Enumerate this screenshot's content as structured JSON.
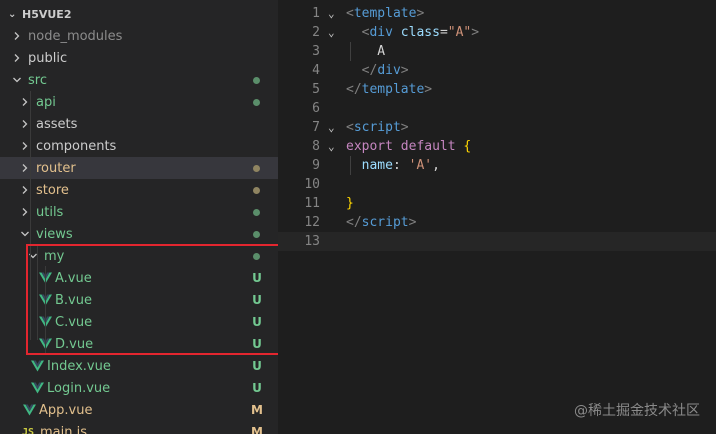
{
  "explorer": {
    "root": "H5VUE2",
    "items": [
      {
        "label": "node_modules",
        "type": "folder",
        "expanded": false,
        "depth": 1,
        "color": "#8c8c8c",
        "status": ""
      },
      {
        "label": "public",
        "type": "folder",
        "expanded": false,
        "depth": 1,
        "color": "#cccccc",
        "status": ""
      },
      {
        "label": "src",
        "type": "folder",
        "expanded": true,
        "depth": 1,
        "color": "#73c991",
        "status": "dot"
      },
      {
        "label": "api",
        "type": "folder",
        "expanded": false,
        "depth": 2,
        "color": "#73c991",
        "status": "dot"
      },
      {
        "label": "assets",
        "type": "folder",
        "expanded": false,
        "depth": 2,
        "color": "#cccccc",
        "status": ""
      },
      {
        "label": "components",
        "type": "folder",
        "expanded": false,
        "depth": 2,
        "color": "#cccccc",
        "status": ""
      },
      {
        "label": "router",
        "type": "folder",
        "expanded": false,
        "depth": 2,
        "color": "#e2c08d",
        "status": "dot-yellow",
        "selected": true
      },
      {
        "label": "store",
        "type": "folder",
        "expanded": false,
        "depth": 2,
        "color": "#e2c08d",
        "status": "dot-yellow"
      },
      {
        "label": "utils",
        "type": "folder",
        "expanded": false,
        "depth": 2,
        "color": "#73c991",
        "status": "dot"
      },
      {
        "label": "views",
        "type": "folder",
        "expanded": true,
        "depth": 2,
        "color": "#73c991",
        "status": "dot"
      },
      {
        "label": "my",
        "type": "folder",
        "expanded": true,
        "depth": 3,
        "color": "#73c991",
        "status": "dot"
      },
      {
        "label": "A.vue",
        "type": "vue",
        "depth": 4,
        "color": "#73c991",
        "status": "U"
      },
      {
        "label": "B.vue",
        "type": "vue",
        "depth": 4,
        "color": "#73c991",
        "status": "U"
      },
      {
        "label": "C.vue",
        "type": "vue",
        "depth": 4,
        "color": "#73c991",
        "status": "U"
      },
      {
        "label": "D.vue",
        "type": "vue",
        "depth": 4,
        "color": "#73c991",
        "status": "U"
      },
      {
        "label": "Index.vue",
        "type": "vue",
        "depth": 3,
        "color": "#73c991",
        "status": "U"
      },
      {
        "label": "Login.vue",
        "type": "vue",
        "depth": 3,
        "color": "#73c991",
        "status": "U"
      },
      {
        "label": "App.vue",
        "type": "vue",
        "depth": 2,
        "color": "#e2c08d",
        "status": "M"
      },
      {
        "label": "main.js",
        "type": "js",
        "depth": 2,
        "color": "#e2c08d",
        "status": "M"
      }
    ]
  },
  "editor": {
    "lines": [
      {
        "n": "1",
        "fold": true,
        "tokens": [
          [
            "punc",
            "<"
          ],
          [
            "tag",
            "template"
          ],
          [
            "punc",
            ">"
          ]
        ]
      },
      {
        "n": "2",
        "fold": true,
        "tokens": [
          [
            "txt",
            "  "
          ],
          [
            "punc",
            "<"
          ],
          [
            "tag",
            "div"
          ],
          [
            "txt",
            " "
          ],
          [
            "attr",
            "class"
          ],
          [
            "txt",
            "="
          ],
          [
            "str",
            "\"A\""
          ],
          [
            "punc",
            ">"
          ]
        ]
      },
      {
        "n": "3",
        "fold": false,
        "tokens": [
          [
            "txt",
            "    A"
          ]
        ]
      },
      {
        "n": "4",
        "fold": false,
        "tokens": [
          [
            "txt",
            "  "
          ],
          [
            "punc",
            "</"
          ],
          [
            "tag",
            "div"
          ],
          [
            "punc",
            ">"
          ]
        ]
      },
      {
        "n": "5",
        "fold": false,
        "tokens": [
          [
            "punc",
            "</"
          ],
          [
            "tag",
            "template"
          ],
          [
            "punc",
            ">"
          ]
        ]
      },
      {
        "n": "6",
        "fold": false,
        "tokens": []
      },
      {
        "n": "7",
        "fold": true,
        "tokens": [
          [
            "punc",
            "<"
          ],
          [
            "tag",
            "script"
          ],
          [
            "punc",
            ">"
          ]
        ]
      },
      {
        "n": "8",
        "fold": true,
        "tokens": [
          [
            "kw",
            "export"
          ],
          [
            "txt",
            " "
          ],
          [
            "kw",
            "default"
          ],
          [
            "txt",
            " "
          ],
          [
            "brace",
            "{"
          ]
        ]
      },
      {
        "n": "9",
        "fold": false,
        "tokens": [
          [
            "txt",
            "  "
          ],
          [
            "prop",
            "name"
          ],
          [
            "txt",
            ": "
          ],
          [
            "str",
            "'A'"
          ],
          [
            "txt",
            ","
          ]
        ]
      },
      {
        "n": "10",
        "fold": false,
        "tokens": []
      },
      {
        "n": "11",
        "fold": false,
        "tokens": [
          [
            "brace",
            "}"
          ]
        ]
      },
      {
        "n": "12",
        "fold": false,
        "tokens": [
          [
            "punc",
            "</"
          ],
          [
            "tag",
            "script"
          ],
          [
            "punc",
            ">"
          ]
        ]
      },
      {
        "n": "13",
        "fold": false,
        "tokens": [],
        "current": true
      }
    ]
  },
  "watermark": "@稀土掘金技术社区"
}
